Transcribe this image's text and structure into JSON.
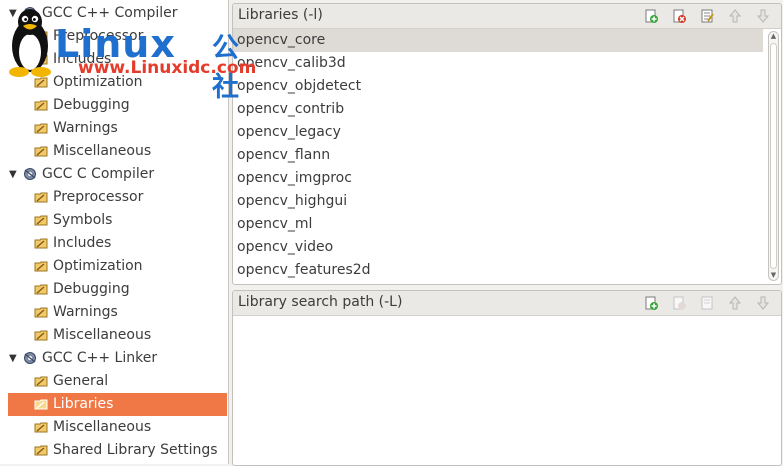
{
  "tree": {
    "groups": [
      {
        "label": "GCC C++ Compiler",
        "children": [
          "Preprocessor",
          "Includes",
          "Optimization",
          "Debugging",
          "Warnings",
          "Miscellaneous"
        ]
      },
      {
        "label": "GCC C Compiler",
        "children": [
          "Preprocessor",
          "Symbols",
          "Includes",
          "Optimization",
          "Debugging",
          "Warnings",
          "Miscellaneous"
        ]
      },
      {
        "label": "GCC C++ Linker",
        "children": [
          "General",
          "Libraries",
          "Miscellaneous",
          "Shared Library Settings"
        ]
      }
    ],
    "selected": "Libraries"
  },
  "libraries_panel": {
    "title": "Libraries (-l)",
    "items": [
      "opencv_core",
      "opencv_calib3d",
      "opencv_objdetect",
      "opencv_contrib",
      "opencv_legacy",
      "opencv_flann",
      "opencv_imgproc",
      "opencv_highgui",
      "opencv_ml",
      "opencv_video",
      "opencv_features2d"
    ],
    "toolbar": [
      "add-icon",
      "delete-icon",
      "edit-icon",
      "move-up-icon",
      "move-down-icon"
    ]
  },
  "search_path_panel": {
    "title": "Library search path (-L)",
    "items": [],
    "toolbar": [
      "add-icon",
      "delete-icon",
      "edit-icon",
      "move-up-icon",
      "move-down-icon"
    ]
  },
  "watermark": {
    "brand": "Linux",
    "brand_cn": "公社",
    "url": "www.Linuxidc.com"
  },
  "colors": {
    "selection": "#f07746",
    "list_first_row": "#dedbd6",
    "panel_header": "#ebe9e6",
    "watermark_blue": "#1f6fce",
    "watermark_red": "#e43b2a"
  }
}
